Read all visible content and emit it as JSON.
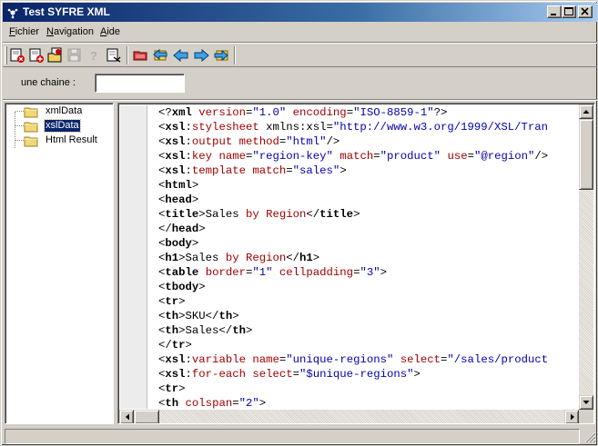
{
  "window": {
    "title": "Test SYFRE XML",
    "title_icon": "app-xml-icon"
  },
  "menu": {
    "items": [
      {
        "label": "Fichier",
        "mnemonic": "F",
        "rest": "ichier"
      },
      {
        "label": "Navigation",
        "mnemonic": "N",
        "rest": "avigation"
      },
      {
        "label": "Aide",
        "mnemonic": "A",
        "rest": "ide"
      }
    ]
  },
  "toolbar": {
    "buttons": [
      {
        "name": "close-document-icon",
        "enabled": true
      },
      {
        "name": "new-document-icon",
        "enabled": true
      },
      {
        "name": "open-document-icon",
        "enabled": true
      },
      {
        "name": "save-icon",
        "enabled": false
      },
      {
        "name": "help-icon",
        "enabled": false
      },
      {
        "name": "properties-icon",
        "enabled": true
      },
      {
        "name": "transform-icon",
        "enabled": true
      },
      {
        "name": "home-icon",
        "enabled": true
      },
      {
        "name": "back-arrow-icon",
        "enabled": true
      },
      {
        "name": "forward-arrow-icon",
        "enabled": true
      },
      {
        "name": "refresh-icon",
        "enabled": true
      }
    ]
  },
  "search": {
    "label": "une chaine :",
    "value": "",
    "placeholder": ""
  },
  "tree": {
    "items": [
      {
        "label": "xmlData",
        "selected": false
      },
      {
        "label": "xslData",
        "selected": true
      },
      {
        "label": "Html Result",
        "selected": false
      }
    ]
  },
  "editor": {
    "lines": [
      [
        [
          "txt",
          "<?"
        ],
        [
          "kw",
          "xml"
        ],
        [
          "txt",
          " "
        ],
        [
          "at",
          "version"
        ],
        [
          "txt",
          "="
        ],
        [
          "st",
          "\"1.0\""
        ],
        [
          "txt",
          " "
        ],
        [
          "at",
          "encoding"
        ],
        [
          "txt",
          "="
        ],
        [
          "st",
          "\"ISO-8859-1\""
        ],
        [
          "txt",
          "?>"
        ]
      ],
      [
        [
          "txt",
          "<"
        ],
        [
          "kw",
          "xsl"
        ],
        [
          "txt",
          ":"
        ],
        [
          "at",
          "stylesheet"
        ],
        [
          "txt",
          " xmlns:xsl="
        ],
        [
          "st",
          "\"http://www.w3.org/1999/XSL/Tran"
        ]
      ],
      [
        [
          "txt",
          "<"
        ],
        [
          "kw",
          "xsl"
        ],
        [
          "txt",
          ":"
        ],
        [
          "at",
          "output"
        ],
        [
          "txt",
          " "
        ],
        [
          "at",
          "method"
        ],
        [
          "txt",
          "="
        ],
        [
          "st",
          "\"html\""
        ],
        [
          "txt",
          "/>"
        ]
      ],
      [
        [
          "txt",
          "<"
        ],
        [
          "kw",
          "xsl"
        ],
        [
          "txt",
          ":"
        ],
        [
          "at",
          "key"
        ],
        [
          "txt",
          " "
        ],
        [
          "at",
          "name"
        ],
        [
          "txt",
          "="
        ],
        [
          "st",
          "\"region-key\""
        ],
        [
          "txt",
          " "
        ],
        [
          "at",
          "match"
        ],
        [
          "txt",
          "="
        ],
        [
          "st",
          "\"product\""
        ],
        [
          "txt",
          " "
        ],
        [
          "at",
          "use"
        ],
        [
          "txt",
          "="
        ],
        [
          "st",
          "\"@region\""
        ],
        [
          "txt",
          "/>"
        ]
      ],
      [
        [
          "txt",
          "<"
        ],
        [
          "kw",
          "xsl"
        ],
        [
          "txt",
          ":"
        ],
        [
          "at",
          "template"
        ],
        [
          "txt",
          " "
        ],
        [
          "at",
          "match"
        ],
        [
          "txt",
          "="
        ],
        [
          "st",
          "\"sales\""
        ],
        [
          "txt",
          ">"
        ]
      ],
      [
        [
          "txt",
          "<"
        ],
        [
          "kw",
          "html"
        ],
        [
          "txt",
          ">"
        ]
      ],
      [
        [
          "txt",
          "<"
        ],
        [
          "kw",
          "head"
        ],
        [
          "txt",
          ">"
        ]
      ],
      [
        [
          "txt",
          "<"
        ],
        [
          "kw",
          "title"
        ],
        [
          "txt",
          ">Sales "
        ],
        [
          "at",
          "by"
        ],
        [
          "txt",
          " "
        ],
        [
          "at",
          "Region"
        ],
        [
          "txt",
          "</"
        ],
        [
          "kw",
          "title"
        ],
        [
          "txt",
          ">"
        ]
      ],
      [
        [
          "txt",
          "</"
        ],
        [
          "kw",
          "head"
        ],
        [
          "txt",
          ">"
        ]
      ],
      [
        [
          "txt",
          "<"
        ],
        [
          "kw",
          "body"
        ],
        [
          "txt",
          ">"
        ]
      ],
      [
        [
          "txt",
          "<"
        ],
        [
          "kw",
          "h1"
        ],
        [
          "txt",
          ">Sales "
        ],
        [
          "at",
          "by"
        ],
        [
          "txt",
          " "
        ],
        [
          "at",
          "Region"
        ],
        [
          "txt",
          "</"
        ],
        [
          "kw",
          "h1"
        ],
        [
          "txt",
          ">"
        ]
      ],
      [
        [
          "txt",
          "<"
        ],
        [
          "kw",
          "table"
        ],
        [
          "txt",
          " "
        ],
        [
          "at",
          "border"
        ],
        [
          "txt",
          "="
        ],
        [
          "st",
          "\"1\""
        ],
        [
          "txt",
          " "
        ],
        [
          "at",
          "cellpadding"
        ],
        [
          "txt",
          "="
        ],
        [
          "st",
          "\"3\""
        ],
        [
          "txt",
          ">"
        ]
      ],
      [
        [
          "txt",
          "<"
        ],
        [
          "kw",
          "tbody"
        ],
        [
          "txt",
          ">"
        ]
      ],
      [
        [
          "txt",
          "<"
        ],
        [
          "kw",
          "tr"
        ],
        [
          "txt",
          ">"
        ]
      ],
      [
        [
          "txt",
          "<"
        ],
        [
          "kw",
          "th"
        ],
        [
          "txt",
          ">SKU</"
        ],
        [
          "kw",
          "th"
        ],
        [
          "txt",
          ">"
        ]
      ],
      [
        [
          "txt",
          "<"
        ],
        [
          "kw",
          "th"
        ],
        [
          "txt",
          ">Sales</"
        ],
        [
          "kw",
          "th"
        ],
        [
          "txt",
          ">"
        ]
      ],
      [
        [
          "txt",
          "</"
        ],
        [
          "kw",
          "tr"
        ],
        [
          "txt",
          ">"
        ]
      ],
      [
        [
          "txt",
          "<"
        ],
        [
          "kw",
          "xsl"
        ],
        [
          "txt",
          ":"
        ],
        [
          "at",
          "variable"
        ],
        [
          "txt",
          " "
        ],
        [
          "at",
          "name"
        ],
        [
          "txt",
          "="
        ],
        [
          "st",
          "\"unique-regions\""
        ],
        [
          "txt",
          " "
        ],
        [
          "at",
          "select"
        ],
        [
          "txt",
          "="
        ],
        [
          "st",
          "\"/sales/product"
        ]
      ],
      [
        [
          "txt",
          "<"
        ],
        [
          "kw",
          "xsl"
        ],
        [
          "txt",
          ":"
        ],
        [
          "at",
          "for-each"
        ],
        [
          "txt",
          " "
        ],
        [
          "at",
          "select"
        ],
        [
          "txt",
          "="
        ],
        [
          "st",
          "\"$unique-regions\""
        ],
        [
          "txt",
          ">"
        ]
      ],
      [
        [
          "txt",
          "<"
        ],
        [
          "kw",
          "tr"
        ],
        [
          "txt",
          ">"
        ]
      ],
      [
        [
          "txt",
          "<"
        ],
        [
          "kw",
          "th"
        ],
        [
          "txt",
          " "
        ],
        [
          "at",
          "colspan"
        ],
        [
          "txt",
          "="
        ],
        [
          "st",
          "\"2\""
        ],
        [
          "txt",
          ">"
        ]
      ]
    ]
  },
  "status": {
    "text": ""
  }
}
